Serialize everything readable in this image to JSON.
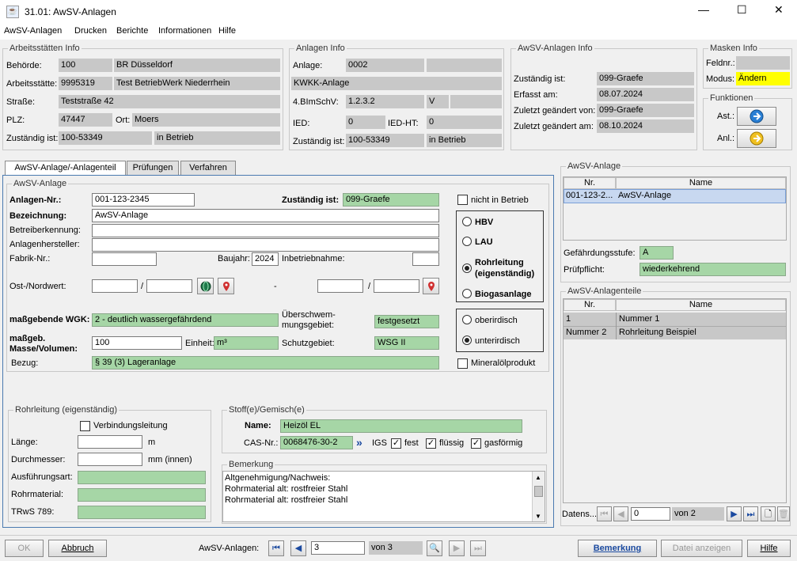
{
  "window": {
    "title": "31.01: AwSV-Anlagen",
    "minimize": "—",
    "maximize": "☐",
    "close": "✕"
  },
  "menu": [
    "AwSV-Anlagen",
    "Drucken",
    "Berichte",
    "Informationen",
    "Hilfe"
  ],
  "arbeitsstaetten": {
    "title": "Arbeitsstätten Info",
    "behoerde_label": "Behörde:",
    "behoerde_code": "100",
    "behoerde_name": "BR Düsseldorf",
    "arbeitsstaette_label": "Arbeitsstätte:",
    "arbeitsstaette_code": "9995319",
    "arbeitsstaette_name": "Test BetriebWerk Niederrhein",
    "strasse_label": "Straße:",
    "strasse": "Teststraße  42",
    "plz_label": "PLZ:",
    "plz": "47447",
    "ort_label": "Ort:",
    "ort": "Moers",
    "zustaendig_label": "Zuständig ist:",
    "zustaendig": "100-53349",
    "status": "in Betrieb"
  },
  "anlagen_info": {
    "title": "Anlagen Info",
    "anlage_label": "Anlage:",
    "anlage": "0002",
    "anlage_extra": "",
    "name": "KWKK-Anlage",
    "bimschv_label": "4.BImSchV:",
    "bimschv": "1.2.3.2",
    "bimschv_v": "V",
    "bimschv_extra": "",
    "ied_label": "IED:",
    "ied": "0",
    "iedht_label": "IED-HT:",
    "iedht": "0",
    "zustaendig_label": "Zuständig ist:",
    "zustaendig": "100-53349",
    "status": "in Betrieb"
  },
  "awsv_info": {
    "title": "AwSV-Anlagen Info",
    "zustaendig_label": "Zuständig ist:",
    "zustaendig": "099-Graefe",
    "erfasst_label": "Erfasst am:",
    "erfasst": "08.07.2024",
    "geaendert_von_label": "Zuletzt geändert von:",
    "geaendert_von": "099-Graefe",
    "geaendert_am_label": "Zuletzt geändert am:",
    "geaendert_am": "08.10.2024"
  },
  "masken_info": {
    "title": "Masken Info",
    "feldnr_label": "Feldnr.:",
    "feldnr": "",
    "modus_label": "Modus:",
    "modus": "Ändern"
  },
  "funktionen": {
    "title": "Funktionen",
    "ast_label": "Ast.:",
    "anl_label": "Anl.:"
  },
  "tabs": [
    "AwSV-Anlage/-Anlagenteil",
    "Prüfungen",
    "Verfahren"
  ],
  "awsv_anlage_form": {
    "title": "AwSV-Anlage",
    "anlagen_nr_label": "Anlagen-Nr.:",
    "anlagen_nr": "001-123-2345",
    "zustaendig_label": "Zuständig ist:",
    "zustaendig": "099-Graefe",
    "nicht_in_betrieb": "nicht in Betrieb",
    "bezeichnung_label": "Bezeichnung:",
    "bezeichnung": "AwSV-Anlage",
    "betreiberkennung_label": "Betreiberkennung:",
    "betreiberkennung": "",
    "hersteller_label": "Anlagenhersteller:",
    "hersteller": "",
    "fabrik_label": "Fabrik-Nr.:",
    "fabrik": "",
    "baujahr_label": "Baujahr:",
    "baujahr": "2024",
    "inbetriebnahme_label": "Inbetriebnahme:",
    "inbetriebnahme": "",
    "ostnord_label": "Ost-/Nordwert:",
    "slash": "/",
    "dash": "-",
    "wgk_label": "maßgebende WGK:",
    "wgk": "2 - deutlich wassergefährdend",
    "ueberschwemmung_label_1": "Überschwem-",
    "ueberschwemmung_label_2": "mungsgebiet:",
    "ueberschwemmung": "festgesetzt",
    "masse_label_1": "maßgeb.",
    "masse_label_2": "Masse/Volumen:",
    "masse": "100",
    "einheit_label": "Einheit:",
    "einheit": "m³",
    "schutzgebiet_label": "Schutzgebiet:",
    "schutzgebiet": "WSG II",
    "bezug_label": "Bezug:",
    "bezug": "§ 39 (3) Lageranlage",
    "mineraloel": "Mineralölprodukt",
    "type_options": [
      "HBV",
      "LAU",
      "Rohrleitung",
      "(eigenständig)",
      "Biogasanlage"
    ],
    "lage_options": [
      "oberirdisch",
      "unterirdisch"
    ]
  },
  "rohrleitung": {
    "title": "Rohrleitung (eigenständig)",
    "verbindung": "Verbindungsleitung",
    "laenge_label": "Länge:",
    "laenge_unit": "m",
    "durchmesser_label": "Durchmesser:",
    "durchmesser_unit": "mm (innen)",
    "ausfuehrung_label": "Ausführungsart:",
    "rohrmaterial_label": "Rohrmaterial:",
    "trws_label": "TRwS 789:"
  },
  "stoff": {
    "title": "Stoff(e)/Gemisch(e)",
    "name_label": "Name:",
    "name": "Heizöl EL",
    "cas_label": "CAS-Nr.:",
    "cas": "0068476-30-2",
    "igs": "IGS",
    "fest": "fest",
    "fluessig": "flüssig",
    "gasfoermig": "gasförmig"
  },
  "bemerkung": {
    "title": "Bemerkung",
    "lines": [
      "Altgenehmigung/Nachweis:",
      "Rohrmaterial alt: rostfreier Stahl",
      "Rohrmaterial alt: rostfreier Stahl"
    ]
  },
  "right_anlage": {
    "title": "AwSV-Anlage",
    "col_nr": "Nr.",
    "col_name": "Name",
    "row_nr": "001-123-2...",
    "row_name": "AwSV-Anlage",
    "gefahr_label": "Gefährdungsstufe:",
    "gefahr": "A",
    "pruef_label": "Prüfpflicht:",
    "pruef": "wiederkehrend"
  },
  "right_teile": {
    "title": "AwSV-Anlagenteile",
    "col_nr": "Nr.",
    "col_name": "Name",
    "rows": [
      {
        "nr": "1",
        "name": "Nummer 1"
      },
      {
        "nr": "Nummer 2",
        "name": "Rohrleitung Beispiel"
      }
    ],
    "datens_label": "Datens...",
    "datens_value": "0",
    "von": "von 2"
  },
  "footer": {
    "ok": "OK",
    "abbruch": "Abbruch",
    "nav_label": "AwSV-Anlagen:",
    "nav_value": "3",
    "nav_von": "von 3",
    "bemerkung": "Bemerkung",
    "datei": "Datei anzeigen",
    "hilfe": "Hilfe"
  }
}
